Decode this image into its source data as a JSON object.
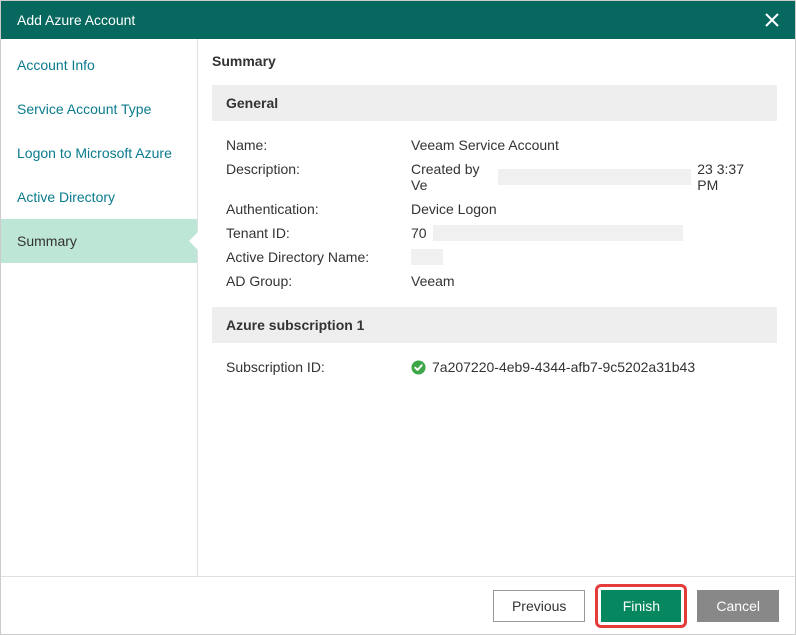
{
  "titlebar": {
    "title": "Add Azure Account"
  },
  "sidebar": {
    "items": [
      {
        "label": "Account Info"
      },
      {
        "label": "Service Account Type"
      },
      {
        "label": "Logon to Microsoft Azure"
      },
      {
        "label": "Active Directory"
      },
      {
        "label": "Summary"
      }
    ]
  },
  "main": {
    "page_title": "Summary",
    "general": {
      "header": "General",
      "rows": {
        "name_label": "Name:",
        "name_value": "Veeam Service Account",
        "description_label": "Description:",
        "description_value_prefix": "Created by Ve",
        "description_value_suffix": "23 3:37 PM",
        "authentication_label": "Authentication:",
        "authentication_value": "Device Logon",
        "tenant_id_label": "Tenant ID:",
        "tenant_id_value_prefix": "70",
        "ad_name_label": "Active Directory Name:",
        "ad_group_label": "AD Group:",
        "ad_group_value": "Veeam"
      }
    },
    "subscription": {
      "header": "Azure subscription 1",
      "id_label": "Subscription ID:",
      "id_value": "7a207220-4eb9-4344-afb7-9c5202a31b43"
    }
  },
  "footer": {
    "previous": "Previous",
    "finish": "Finish",
    "cancel": "Cancel"
  }
}
